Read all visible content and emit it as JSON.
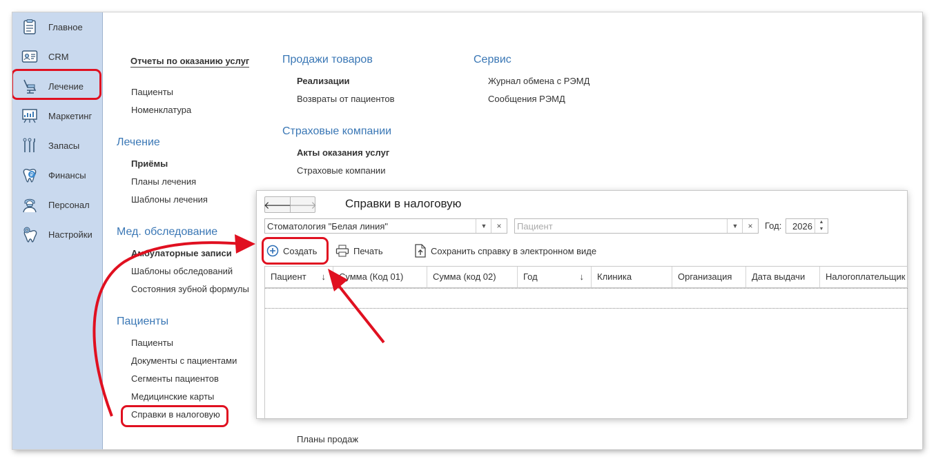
{
  "sidebar": {
    "items": [
      {
        "label": "Главное",
        "icon": "clipboard-icon"
      },
      {
        "label": "CRM",
        "icon": "id-card-icon"
      },
      {
        "label": "Лечение",
        "icon": "dental-chair-icon"
      },
      {
        "label": "Маркетинг",
        "icon": "chart-board-icon"
      },
      {
        "label": "Запасы",
        "icon": "dental-tools-icon"
      },
      {
        "label": "Финансы",
        "icon": "tooth-coin-icon"
      },
      {
        "label": "Персонал",
        "icon": "doctor-icon"
      },
      {
        "label": "Настройки",
        "icon": "tooth-gear-icon"
      }
    ]
  },
  "menu": {
    "col1": {
      "reports_link": "Отчеты по оказанию услуг",
      "links_top": [
        "Пациенты",
        "Номенклатура"
      ],
      "treatment": {
        "title": "Лечение",
        "links": [
          "Приёмы",
          "Планы лечения",
          "Шаблоны лечения"
        ]
      },
      "exam": {
        "title": "Мед. обследование",
        "links": [
          "Амбулаторные записи",
          "Шаблоны обследований",
          "Состояния зубной формулы"
        ]
      },
      "patients": {
        "title": "Пациенты",
        "links": [
          "Пациенты",
          "Документы с пациентами",
          "Сегменты пациентов",
          "Медицинские карты",
          "Справки в налоговую"
        ]
      }
    },
    "col2": {
      "sales": {
        "title": "Продажи товаров",
        "links": [
          "Реализации",
          "Возвраты от пациентов"
        ]
      },
      "insurance": {
        "title": "Страховые компании",
        "links": [
          "Акты оказания услуг",
          "Страховые компании"
        ]
      },
      "bottom_link": "Планы продаж"
    },
    "col3": {
      "service": {
        "title": "Сервис",
        "links": [
          "Журнал обмена с РЭМД",
          "Сообщения РЭМД"
        ]
      }
    }
  },
  "dialog": {
    "title": "Справки в налоговую",
    "clinic_value": "Стоматология \"Белая линия\"",
    "patient_placeholder": "Пациент",
    "year_label": "Год:",
    "year_value": "2026",
    "toolbar": {
      "create": "Создать",
      "print": "Печать",
      "save_electronic": "Сохранить справку в электронном виде"
    },
    "columns": [
      "Пациент",
      "Сумма (Код 01)",
      "Сумма (код 02)",
      "Год",
      "Клиника",
      "Организация",
      "Дата выдачи",
      "Налогоплательщик"
    ],
    "rows": []
  },
  "colors": {
    "sidebar_bg": "#c9d9ee",
    "section_title": "#3a77b5",
    "annotation": "#e01020"
  }
}
